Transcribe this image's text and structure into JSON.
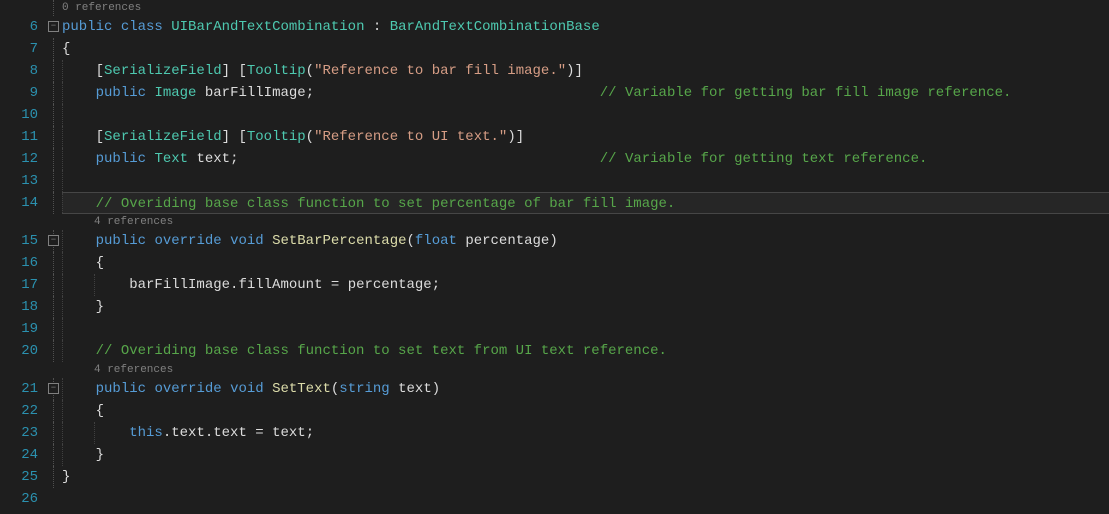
{
  "lineNumbers": [
    "6",
    "7",
    "8",
    "9",
    "10",
    "11",
    "12",
    "13",
    "14",
    "15",
    "16",
    "17",
    "18",
    "19",
    "20",
    "21",
    "22",
    "23",
    "24",
    "25",
    "26"
  ],
  "refs": {
    "r0": "0 references",
    "r4a": "4 references",
    "r4b": "4 references"
  },
  "code": {
    "l6": {
      "kw1": "public",
      "kw2": "class",
      "cls": "UIBarAndTextCombination",
      "colon": " : ",
      "base": "BarAndTextCombinationBase"
    },
    "l7": {
      "brace": "{"
    },
    "l8": {
      "attr1o": "[",
      "attr1": "SerializeField",
      "attr1c": "] [",
      "attr2": "Tooltip",
      "paren": "(",
      "str": "\"Reference to bar fill image.\"",
      "close": ")]"
    },
    "l9": {
      "kw": "public",
      "type": "Image",
      "name": "barFillImage",
      "semi": ";",
      "cmt": "// Variable for getting bar fill image reference."
    },
    "l11": {
      "attr1o": "[",
      "attr1": "SerializeField",
      "attr1c": "] [",
      "attr2": "Tooltip",
      "paren": "(",
      "str": "\"Reference to UI text.\"",
      "close": ")]"
    },
    "l12": {
      "kw": "public",
      "type": "Text",
      "name": "text",
      "semi": ";",
      "cmt": "// Variable for getting text reference."
    },
    "l14": {
      "cmt": "// Overiding base class function to set percentage of bar fill image."
    },
    "l15": {
      "kw1": "public",
      "kw2": "override",
      "kw3": "void",
      "method": "SetBarPercentage",
      "po": "(",
      "ptype": "float",
      "pname": " percentage",
      "pc": ")"
    },
    "l16": {
      "brace": "{"
    },
    "l17": {
      "obj": "barFillImage",
      "dot1": ".",
      "prop": "fillAmount",
      "eq": " = ",
      "val": "percentage",
      "semi": ";"
    },
    "l18": {
      "brace": "}"
    },
    "l20": {
      "cmt": "// Overiding base class function to set text from UI text reference."
    },
    "l21": {
      "kw1": "public",
      "kw2": "override",
      "kw3": "void",
      "method": "SetText",
      "po": "(",
      "ptype": "string",
      "pname": " text",
      "pc": ")"
    },
    "l22": {
      "brace": "{"
    },
    "l23": {
      "kw": "this",
      "d1": ".",
      "f1": "text",
      "d2": ".",
      "f2": "text",
      "eq": " = ",
      "val": "text",
      "semi": ";"
    },
    "l24": {
      "brace": "}"
    },
    "l25": {
      "brace": "}"
    }
  }
}
